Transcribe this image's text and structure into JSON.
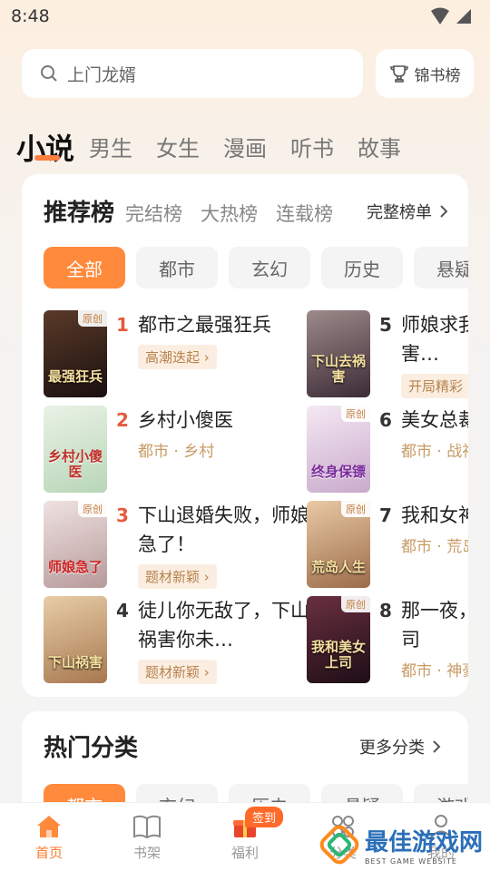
{
  "status": {
    "time": "8:48"
  },
  "search": {
    "placeholder": "上门龙婿",
    "rank_label": "锦书榜"
  },
  "channels": [
    "小说",
    "男生",
    "女生",
    "漫画",
    "听书",
    "故事"
  ],
  "ranking": {
    "title": "推荐榜",
    "subtabs": [
      "完结榜",
      "大热榜",
      "连载榜"
    ],
    "full_list": "完整榜单",
    "chips": [
      "全部",
      "都市",
      "玄幻",
      "历史",
      "悬疑"
    ],
    "books": [
      {
        "rank": "1",
        "title": "都市之最强狂兵",
        "tag": "高潮迭起",
        "original": true,
        "cover_text": "最强狂兵",
        "cover_color": "#2a1d16"
      },
      {
        "rank": "2",
        "title": "乡村小傻医",
        "meta": "都市 · 乡村",
        "original": false,
        "cover_text": "乡村小傻医",
        "cover_color": "#cfe4cf"
      },
      {
        "rank": "3",
        "title": "下山退婚失败，师娘急了！",
        "tag": "题材新颖",
        "original": true,
        "cover_text": "师娘急了",
        "cover_color": "#d8c0c0"
      },
      {
        "rank": "4",
        "title": "徒儿你无敌了，下山祸害你未…",
        "tag": "题材新颖",
        "original": false,
        "cover_text": "下山祸害",
        "cover_color": "#c9a27a"
      },
      {
        "rank": "5",
        "title": "师娘求我下山去祸害…",
        "tag": "开局精彩",
        "original": false,
        "cover_text": "下山去祸害",
        "cover_color": "#5d4a52"
      },
      {
        "rank": "6",
        "title": "美女总裁的贴身保镖",
        "meta": "都市 · 战神",
        "original": true,
        "cover_text": "终身保镖",
        "cover_color": "#e7d3e6"
      },
      {
        "rank": "7",
        "title": "我和女神荒岛人生",
        "meta": "都市 · 荒岛",
        "original": true,
        "cover_text": "荒岛人生",
        "cover_color": "#c7a07a"
      },
      {
        "rank": "8",
        "title": "那一夜，我和美女上司",
        "meta": "都市 · 神豪",
        "original": true,
        "cover_text": "我和美女上司",
        "cover_color": "#3a1e2a"
      }
    ]
  },
  "hot": {
    "title": "热门分类",
    "more": "更多分类",
    "chips": [
      "都市",
      "玄幻",
      "历史",
      "悬疑",
      "游戏"
    ]
  },
  "nav": {
    "items": [
      "首页",
      "书架",
      "福利",
      "分类",
      "我的"
    ],
    "badge": "签到"
  },
  "watermark": {
    "title": "最佳游戏网",
    "sub": "BEST GAME WEBSITE"
  },
  "colors": {
    "accent": "#ff8a3c",
    "rank_red": "#e35b3c",
    "tag_bg": "#fbeee1"
  }
}
